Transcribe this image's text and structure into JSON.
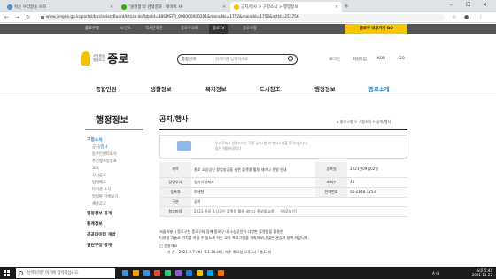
{
  "browser": {
    "tabs": [
      {
        "label": "쉬운 우리말을 쓰자",
        "favicon_color": "#4a90d9",
        "active": false
      },
      {
        "label": "\"블랫폼'의 검색결과 : 네이버 사",
        "favicon_color": "#2db400",
        "active": false
      },
      {
        "label": "공지/행사 > 구청소식 > 행정정보",
        "favicon_color": "#f4c300",
        "active": true
      }
    ],
    "new_tab": "+",
    "url": "www.jongno.go.kr/portal/bbs/selectBoardArticle.do?bbsId=BBSMSTR_000000000201&menuNo=1752&menuId=1752&nttId=251756",
    "window_controls": [
      "–",
      "☐",
      "✕"
    ]
  },
  "site_nav": {
    "items": [
      "종로구청",
      "보건소",
      "역사문화관",
      "종로구의회",
      "종로TV",
      "종로사랑"
    ],
    "active": "종로TV",
    "right_button": "종로구 바로가기 GO"
  },
  "header": {
    "logo_sub1": "사람중심",
    "logo_sub2": "명품도시",
    "logo_title": "종로",
    "search_scope": "통합검색",
    "search_placeholder": "검색어를 입력하세요.",
    "util": [
      "로그인",
      "회원가입",
      "KOR",
      "GO"
    ]
  },
  "main_nav": {
    "items": [
      "종합민원",
      "생활정보",
      "복지정보",
      "도시창조",
      "행정정보",
      "종로소개"
    ],
    "active": "종로소개"
  },
  "left_menu": {
    "title": "행정정보",
    "section": "구청소식",
    "items": [
      "공지/행사",
      "동주민센터소식",
      "주간행사일정표",
      "교육",
      "고시공고",
      "입법예고",
      "타기관 소식",
      "알림판 전체보기",
      "채용공고"
    ],
    "selected": "공지/행사",
    "groups": [
      "행정정보 공개",
      "통계정보",
      "공공데이터 개방",
      "열린구정 공개"
    ]
  },
  "content": {
    "title": "공지/행사",
    "breadcrumb": "⌂ 종로구청 > 구청소식 > 공지/행사",
    "notice_line1": "우리구에서 알려드리는 각종 공지사항과 행사소식을 알려드립니다.",
    "notice_line2": "많은 애용바랍니다.",
    "table": {
      "labels": {
        "title": "제목",
        "dept": "담당부서",
        "writer": "등록자",
        "category": "구분",
        "attach": "첨부파일",
        "regdate": "등록일",
        "views": "조회수",
        "phone": "전화번호"
      },
      "title": "종로 소상공인 창업성공을 위한 플랫폼 활용 세미나 운영 안내",
      "dept": "일자리경제과",
      "writer": "하세현",
      "category": "공지",
      "attach": "2021 종로 소상공인 플랫폼 활용 세미나 홍보물.pdf",
      "preview": "[바로보기]",
      "regdate": "2021년09월02일",
      "views": "43",
      "phone": "02-2148-3253"
    },
    "body_line1": "서울특별시 종로구는 종로구와 함께 종로구 내 소상공인이 다양한 플랫폼을 활용한",
    "body_line2": "디지털 기술로 가치를 키울 수 있도록 하는 교육 프로그램을 개최하오니 많은 관심과 참여 바랍니다.",
    "body_line3": "□ 운영개요",
    "body_line4": "- 기      간 : 2021.9.7.(화)~11.30.(화), 매주 화요일 오후3시 / 총13회"
  },
  "taskbar": {
    "search_placeholder": "검색하려면 여기에 입력하십시오.",
    "apps": [
      "#4a90d9",
      "#f4a100",
      "#3c8de8",
      "#e24c3c",
      "#2ecc71",
      "#8a5cd8",
      "#1e7bd7",
      "#f4c300",
      "#00a4ef",
      "#ff6f00"
    ],
    "tray_text": "A 아",
    "time": "오후 5:44",
    "date": "2021-11-22"
  }
}
